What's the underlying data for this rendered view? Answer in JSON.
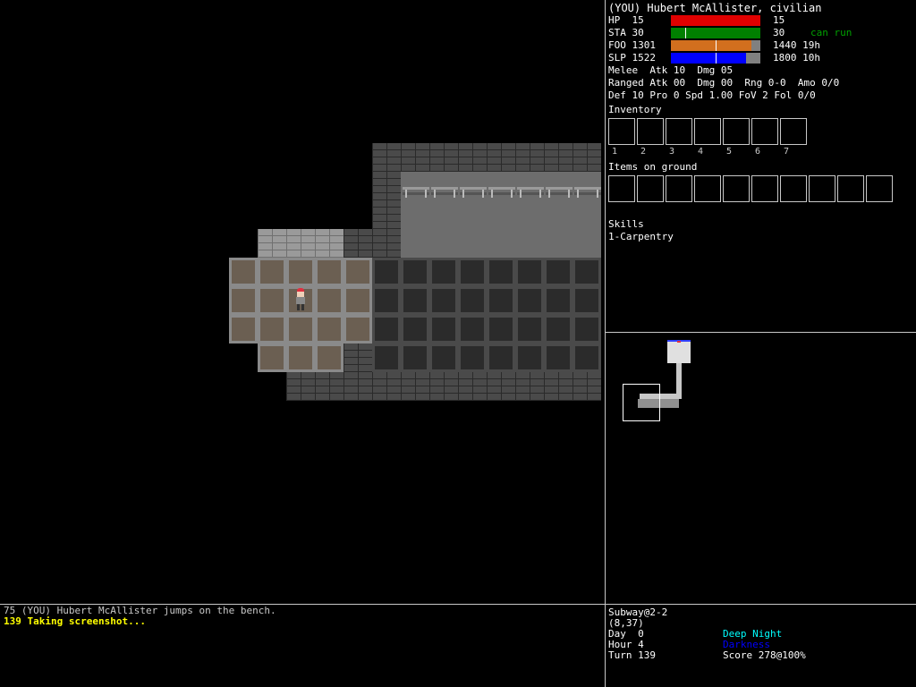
{
  "character": {
    "title": "(YOU) Hubert McAllister, civilian"
  },
  "stats": [
    {
      "label": "HP  15  ",
      "max": "15",
      "extra": "",
      "fill_pct": 100,
      "color": "#e00000",
      "mark_pct": null
    },
    {
      "label": "STA 30  ",
      "max": "30",
      "extra": "can run",
      "fill_pct": 100,
      "color": "#008000",
      "mark_pct": 16
    },
    {
      "label": "FOO 1301",
      "max": "1440 19h",
      "extra": "",
      "fill_pct": 90,
      "color": "#d26f1e",
      "mark_pct": 50
    },
    {
      "label": "SLP 1522",
      "max": "1800 10h",
      "extra": "",
      "fill_pct": 84,
      "color": "#0000ff",
      "mark_pct": 50
    }
  ],
  "combat": {
    "melee": "Melee  Atk 10  Dmg 05",
    "ranged": "Ranged Atk 00  Dmg 00  Rng 0-0  Amo 0/0",
    "defense": "Def 10 Pro 0 Spd 1.00 FoV 2 Fol 0/0"
  },
  "inventory": {
    "label": "Inventory",
    "slots": [
      "1",
      "2",
      "3",
      "4",
      "5",
      "6",
      "7"
    ]
  },
  "ground": {
    "label": "Items on ground",
    "slot_count": 10
  },
  "skills": {
    "label": "Skills",
    "items": [
      "1-Carpentry"
    ]
  },
  "messages": [
    {
      "text": "75 (YOU) Hubert McAllister jumps on the bench.",
      "color": "#c8c8c8"
    },
    {
      "text": "139 Taking screenshot...",
      "color": "#ffff00"
    }
  ],
  "status": {
    "location": "Subway@2-2",
    "coords": "(8,37)",
    "day": "Day  0",
    "hour": "Hour 4",
    "turn": "Turn 139",
    "time_of_day": "Deep Night",
    "light": "Darkness",
    "score": "Score 278@100%"
  },
  "colors": {
    "accent_cyan": "#00ffff",
    "accent_blue": "#0000ff",
    "can_run": "#00a000",
    "message_yellow": "#ffff00"
  }
}
